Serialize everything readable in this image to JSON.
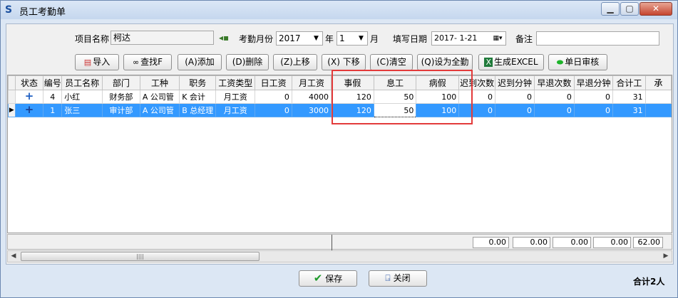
{
  "window": {
    "title": "员工考勤单",
    "icon": "app-s-icon"
  },
  "form": {
    "project_label": "项目名称",
    "project_value": "柯达",
    "month_label": "考勤月份",
    "year_value": "2017",
    "year_suffix": "年",
    "month_value": "1",
    "month_suffix": "月",
    "date_label": "填写日期",
    "date_value": "2017- 1-21",
    "note_label": "备注",
    "note_value": ""
  },
  "toolbar": [
    {
      "name": "import-button",
      "label": "导入",
      "icon": "import-icon"
    },
    {
      "name": "find-button",
      "label": "查找F",
      "icon": "binoculars-icon"
    },
    {
      "name": "add-button",
      "label": "(A)添加"
    },
    {
      "name": "delete-button",
      "label": "(D)删除"
    },
    {
      "name": "move-up-button",
      "label": "(Z)上移"
    },
    {
      "name": "move-down-button",
      "label": "(X) 下移"
    },
    {
      "name": "clear-button",
      "label": "(C)清空"
    },
    {
      "name": "set-full-attendance-button",
      "label": "(Q)设为全勤"
    },
    {
      "name": "export-excel-button",
      "label": "生成EXCEL",
      "icon": "excel-icon"
    },
    {
      "name": "daily-review-button",
      "label": "单日审核",
      "icon": "green-pill-icon"
    }
  ],
  "table": {
    "columns": [
      "状态",
      "编号",
      "员工名称",
      "部门",
      "工种",
      "职务",
      "工资类型",
      "日工资",
      "月工资",
      "事假",
      "息工",
      "病假",
      "迟到次数",
      "迟到分钟",
      "早退次数",
      "早退分钟",
      "合计工",
      "承"
    ],
    "rows": [
      {
        "status": "+",
        "id": "4",
        "name": "小红",
        "dept": "财务部",
        "worktype": "A 公司管",
        "position": "K 会计",
        "paytype": "月工资",
        "daily": "0",
        "monthly": "4000",
        "personal_leave": "120",
        "rest": "50",
        "sick": "100",
        "late_count": "0",
        "late_min": "0",
        "early_count": "0",
        "early_min": "0",
        "total": "31",
        "extra": ""
      },
      {
        "status": "+",
        "id": "1",
        "name": "张三",
        "dept": "审计部",
        "worktype": "A 公司管",
        "position": "B 总经理",
        "paytype": "月工资",
        "daily": "0",
        "monthly": "3000",
        "personal_leave": "120",
        "rest": "50",
        "sick": "100",
        "late_count": "0",
        "late_min": "0",
        "early_count": "0",
        "early_min": "0",
        "total": "31",
        "extra": ""
      }
    ],
    "selected_row_index": 1
  },
  "summary": {
    "late_count": "0.00",
    "late_min": "0.00",
    "early_count": "0.00",
    "early_min": "0.00",
    "total": "62.00"
  },
  "bottom": {
    "save_label": "保存",
    "close_label": "关闭",
    "total_people": "合计2人"
  },
  "colors": {
    "selection": "#3399ff",
    "highlight_box": "#e33a3a"
  }
}
